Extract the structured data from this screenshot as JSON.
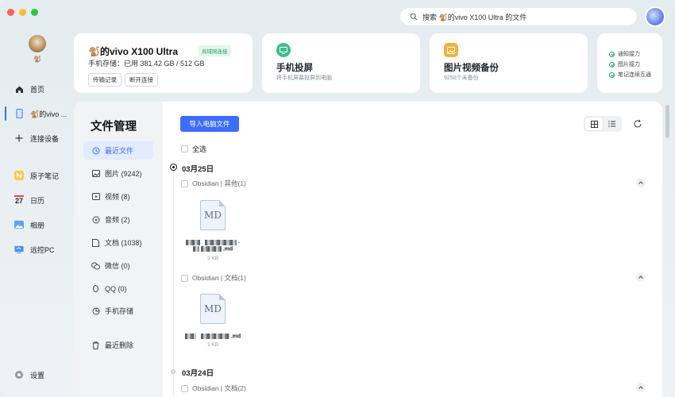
{
  "search": {
    "placeholder": "搜索 🐒的vivo X100 Ultra 的文件"
  },
  "sidebar": {
    "avatar_tag": "🐒",
    "items": [
      {
        "label": "首页",
        "icon": "home-icon"
      },
      {
        "label": "🐒的vivo ...",
        "icon": "phone-icon"
      },
      {
        "label": "连接设备",
        "icon": "plus-icon"
      },
      {
        "label": "原子笔记",
        "icon": "notes-icon"
      },
      {
        "label": "日历",
        "icon": "calendar-icon",
        "day": "27"
      },
      {
        "label": "相册",
        "icon": "album-icon"
      },
      {
        "label": "远控PC",
        "icon": "remote-pc-icon"
      }
    ],
    "settings_label": "设置"
  },
  "device": {
    "title": "🐒的vivo X100 Ultra",
    "badge": "局域网连接",
    "storage": "手机存储：已用 381.42 GB / 512 GB",
    "btn_transfer": "传输记录",
    "btn_disconnect": "断开连接"
  },
  "features": {
    "screen": {
      "title": "手机投屏",
      "subtitle": "将手机屏幕投屏到电脑"
    },
    "backup": {
      "title": "图片视频备份",
      "subtitle": "9250个未备份"
    }
  },
  "relay": {
    "items": [
      "通知接力",
      "图片接力",
      "笔记连续互通"
    ]
  },
  "file_manager": {
    "title": "文件管理",
    "nav": [
      {
        "label": "最近文件",
        "icon": "clock-icon"
      },
      {
        "label": "图片 (9242)",
        "icon": "image-icon"
      },
      {
        "label": "视频 (8)",
        "icon": "video-icon"
      },
      {
        "label": "音频 (2)",
        "icon": "audio-icon"
      },
      {
        "label": "文档 (1038)",
        "icon": "document-icon"
      },
      {
        "label": "微信 (0)",
        "icon": "wechat-icon"
      },
      {
        "label": "QQ (0)",
        "icon": "qq-icon"
      },
      {
        "label": "手机存储",
        "icon": "storage-icon"
      },
      {
        "label": "最近删除",
        "icon": "trash-icon"
      }
    ],
    "import_button": "导入电脑文件",
    "select_all": "全选",
    "groups": [
      {
        "date": "03月25日",
        "sources": [
          {
            "label": "Obsidian | 其他(1)",
            "file": {
              "ext_label": "MD",
              "name_suffix": ".md",
              "name_prefix": "-",
              "size": "3 KB"
            }
          },
          {
            "label": "Obsidian | 文档(1)",
            "file": {
              "ext_label": "MD",
              "name_suffix": ".md",
              "size": "1 KB"
            }
          }
        ]
      },
      {
        "date": "03月24日",
        "sources": [
          {
            "label": "Obsidian | 文档(2)"
          }
        ]
      }
    ]
  },
  "colors": {
    "accent": "#3d6dff",
    "success": "#2aa06f"
  }
}
